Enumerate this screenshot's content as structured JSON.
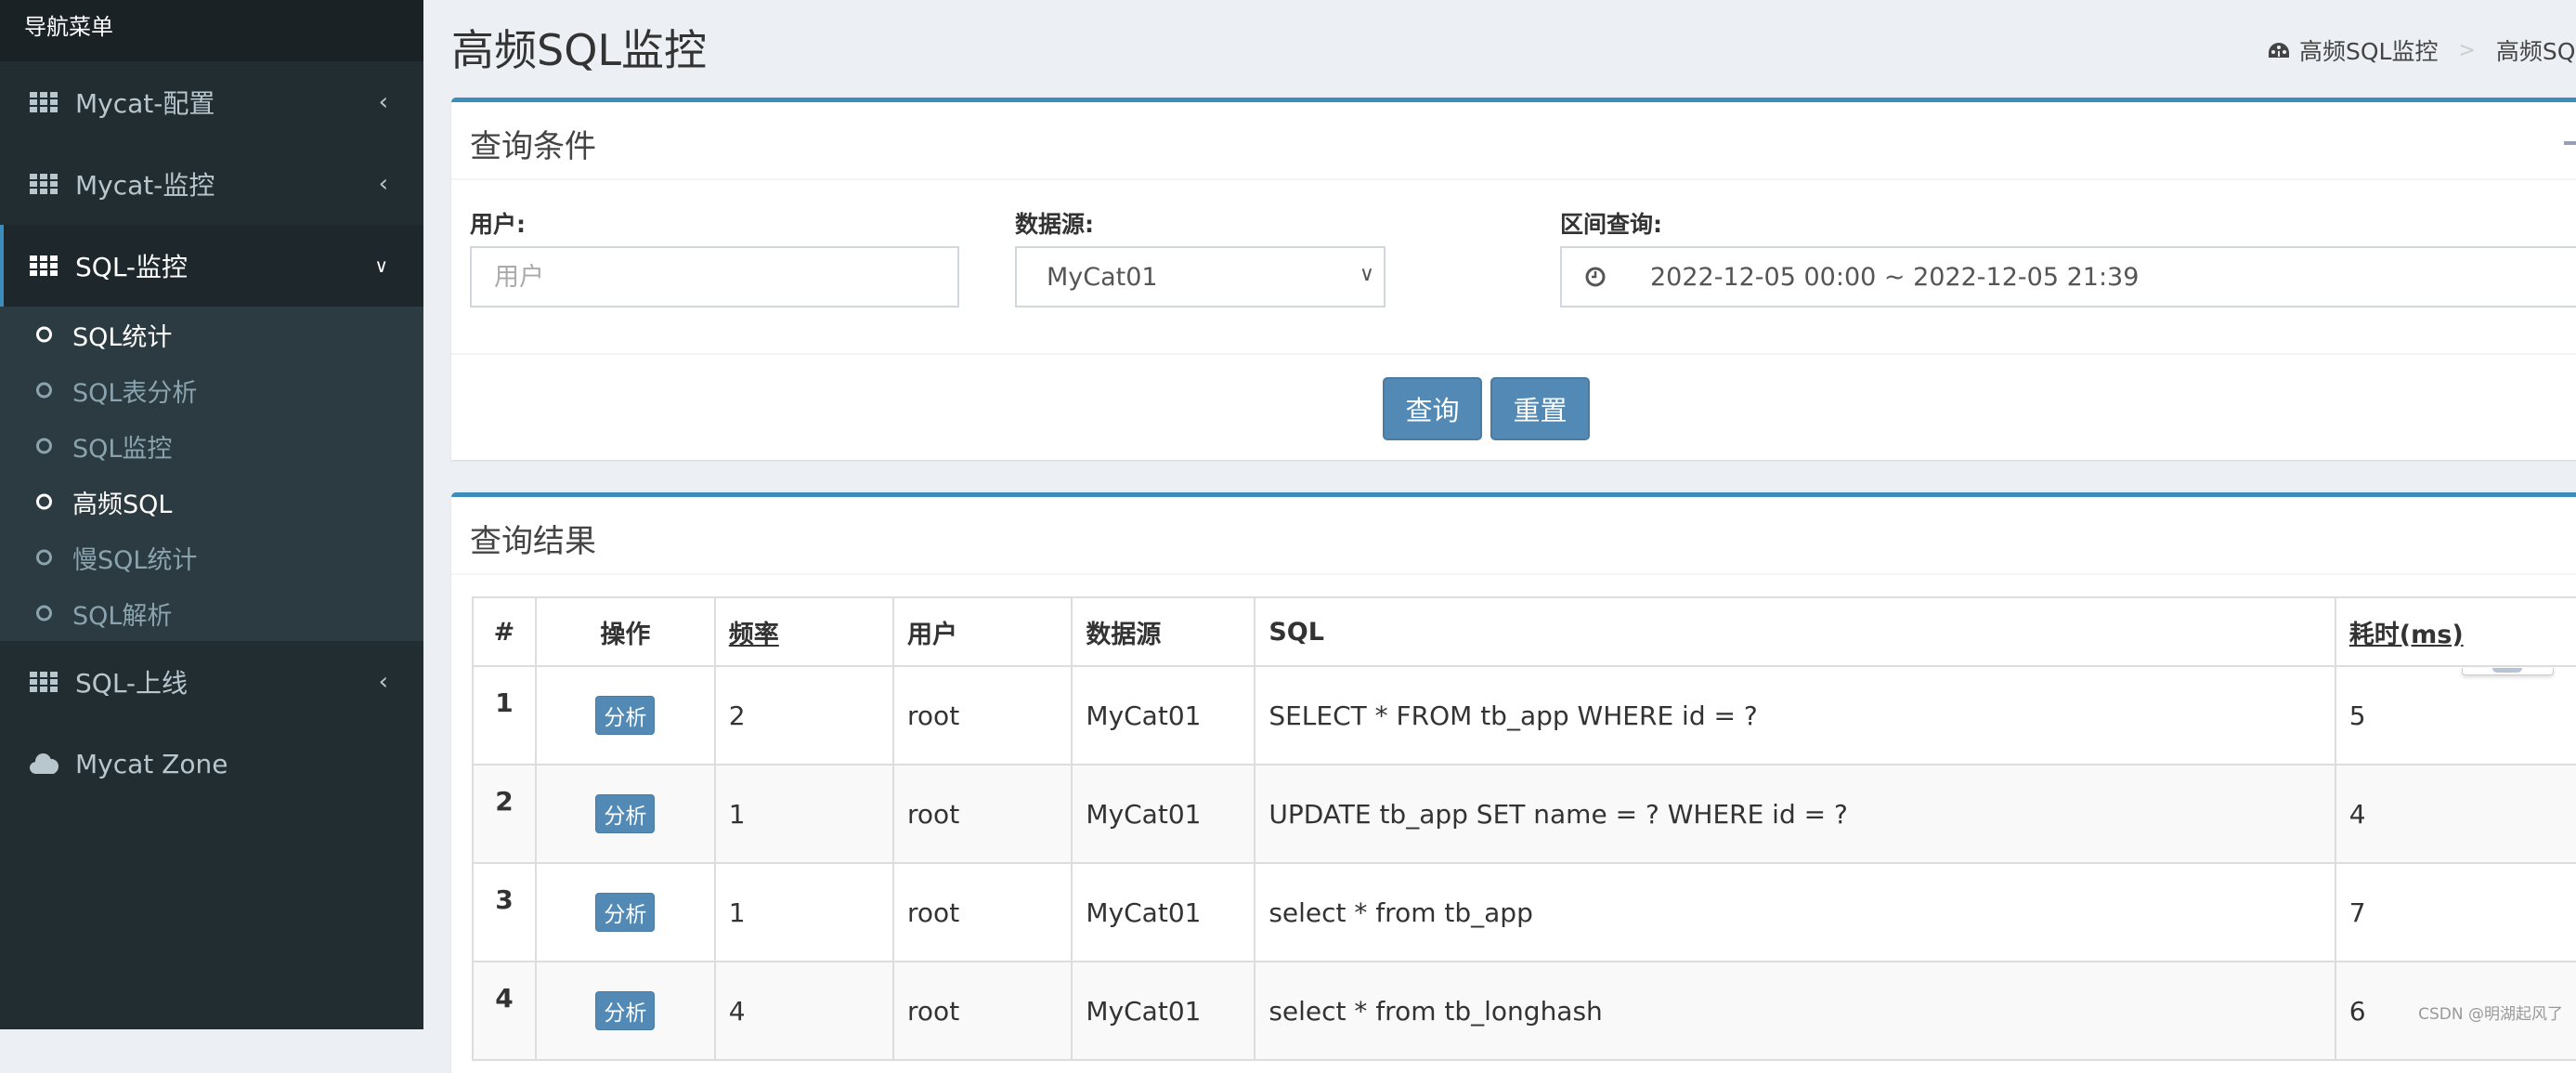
{
  "sidebar": {
    "header": "导航菜单",
    "items": [
      {
        "label": "Mycat-配置",
        "icon": "th-grid-icon",
        "expanded": false
      },
      {
        "label": "Mycat-监控",
        "icon": "th-grid-icon",
        "expanded": false
      },
      {
        "label": "SQL-监控",
        "icon": "th-grid-icon",
        "expanded": true,
        "children": [
          {
            "label": "SQL统计",
            "highlighted": true
          },
          {
            "label": "SQL表分析",
            "highlighted": false
          },
          {
            "label": "SQL监控",
            "highlighted": false
          },
          {
            "label": "高频SQL",
            "highlighted": true
          },
          {
            "label": "慢SQL统计",
            "highlighted": false
          },
          {
            "label": "SQL解析",
            "highlighted": false
          }
        ]
      },
      {
        "label": "SQL-上线",
        "icon": "th-grid-icon",
        "expanded": false
      },
      {
        "label": "Mycat Zone",
        "icon": "cloud-icon"
      }
    ]
  },
  "header": {
    "title": "高频SQL监控",
    "breadcrumb": [
      {
        "label": "高频SQL监控",
        "icon": "dashboard-icon"
      },
      {
        "label": "高频SQL监控"
      }
    ],
    "breadcrumb_separator": ">"
  },
  "query_box": {
    "title": "查询条件",
    "collapse_icon": "minus-icon",
    "fields": {
      "user": {
        "label": "用户:",
        "placeholder": "用户",
        "value": ""
      },
      "datasource": {
        "label": "数据源:",
        "selected": "MyCat01"
      },
      "range": {
        "label": "区间查询:",
        "icon": "clock-icon",
        "value": "2022-12-05 00:00 ~ 2022-12-05 21:39"
      }
    },
    "buttons": {
      "query": "查询",
      "reset": "重置"
    }
  },
  "result_box": {
    "title": "查询结果",
    "columns": [
      "#",
      "操作",
      "频率",
      "用户",
      "数据源",
      "SQL",
      "耗时(ms)"
    ],
    "rows": [
      {
        "idx": "1",
        "action": "分析",
        "freq": "2",
        "user": "root",
        "ds": "MyCat01",
        "sql": "SELECT * FROM tb_app WHERE id = ?",
        "ms": "5"
      },
      {
        "idx": "2",
        "action": "分析",
        "freq": "1",
        "user": "root",
        "ds": "MyCat01",
        "sql": "UPDATE tb_app SET name = ? WHERE id = ?",
        "ms": "4"
      },
      {
        "idx": "3",
        "action": "分析",
        "freq": "1",
        "user": "root",
        "ds": "MyCat01",
        "sql": "select * from tb_app",
        "ms": "7"
      },
      {
        "idx": "4",
        "action": "分析",
        "freq": "4",
        "user": "root",
        "ds": "MyCat01",
        "sql": "select * from tb_longhash",
        "ms": "6"
      }
    ]
  },
  "watermark": "CSDN @明湖起风了",
  "colors": {
    "sidebar_bg": "#222d32",
    "submenu_bg": "#2c3b41",
    "accent": "#3c8dbc",
    "button": "#5289b5",
    "page_bg": "#ecf0f5"
  }
}
